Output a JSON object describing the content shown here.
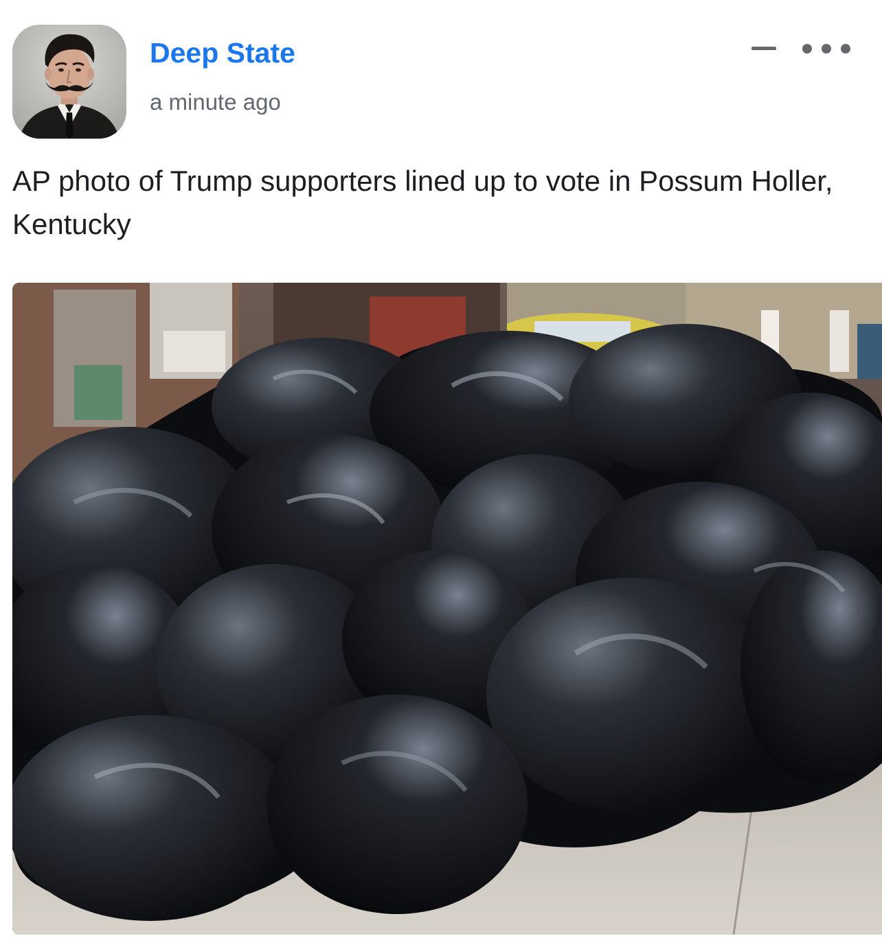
{
  "post": {
    "author": {
      "name": "Deep State",
      "avatar_icon": "profile-portrait-icon"
    },
    "timestamp": "a minute ago",
    "caption": "AP photo of Trump supporters lined up to vote in Possum Holler, Kentucky",
    "actions": {
      "minimize_icon": "minimize-icon",
      "more_icon": "more-options-icon"
    },
    "colors": {
      "author_link": "#1877f2",
      "meta_text": "#606770",
      "body_text": "#1c1e21",
      "icon_gray": "#65676b"
    },
    "photo": {
      "subject": "pile of black trash bags on a sidewalk"
    }
  }
}
